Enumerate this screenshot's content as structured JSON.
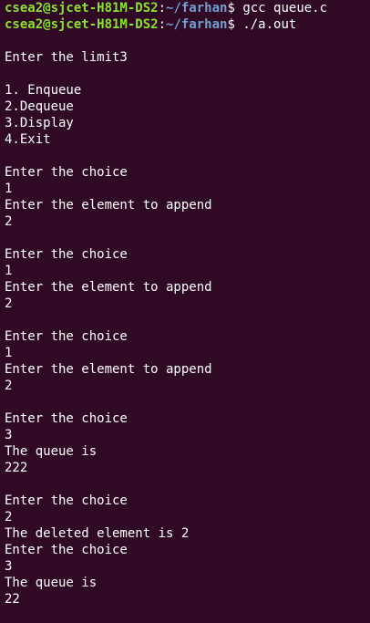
{
  "colors": {
    "background": "#300a24",
    "text": "#ffffff",
    "prompt_user": "#8ae234",
    "prompt_path": "#729fcf"
  },
  "prompts": [
    {
      "user_host": "csea2@sjcet-H81M-DS2",
      "sep": ":",
      "path": "~/farhan",
      "symbol": "$",
      "command": " gcc queue.c"
    },
    {
      "user_host": "csea2@sjcet-H81M-DS2",
      "sep": ":",
      "path": "~/farhan",
      "symbol": "$",
      "command": " ./a.out"
    }
  ],
  "output": [
    "",
    "Enter the limit3",
    "",
    "1. Enqueue",
    "2.Dequeue",
    "3.Display",
    "4.Exit",
    "",
    "Enter the choice",
    "1",
    "Enter the element to append",
    "2",
    "",
    "Enter the choice",
    "1",
    "Enter the element to append",
    "2",
    "",
    "Enter the choice",
    "1",
    "Enter the element to append",
    "2",
    "",
    "Enter the choice",
    "3",
    "The queue is",
    "222",
    "",
    "Enter the choice",
    "2",
    "The deleted element is 2",
    "Enter the choice",
    "3",
    "The queue is",
    "22",
    ""
  ]
}
